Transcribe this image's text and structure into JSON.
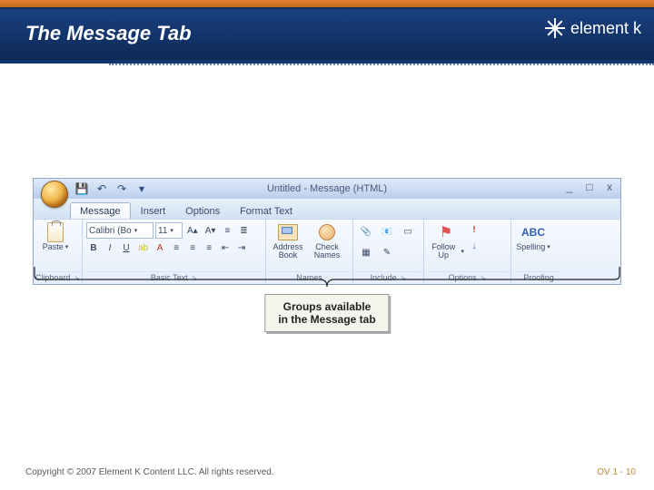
{
  "brand": "element k",
  "page_title": "The Message Tab",
  "window": {
    "title": "Untitled - Message (HTML)",
    "qat": [
      "save-icon",
      "undo-icon",
      "redo-icon"
    ],
    "controls": {
      "min": "_",
      "max": "□",
      "close": "x"
    }
  },
  "tabs": [
    {
      "label": "Message",
      "active": true
    },
    {
      "label": "Insert",
      "active": false
    },
    {
      "label": "Options",
      "active": false
    },
    {
      "label": "Format Text",
      "active": false
    }
  ],
  "groups": {
    "clipboard": {
      "label": "Clipboard",
      "paste": "Paste"
    },
    "basictext": {
      "label": "Basic Text",
      "font": "Calibri (Bo",
      "size": "11",
      "btns": {
        "bold": "B",
        "italic": "I",
        "underline": "U"
      }
    },
    "names": {
      "label": "Names",
      "address": "Address Book",
      "check": "Check Names"
    },
    "include": {
      "label": "Include"
    },
    "options": {
      "label": "Options",
      "followup": "Follow Up"
    },
    "proofing": {
      "label": "Proofing",
      "spelling": "Spelling",
      "abc": "ABC"
    }
  },
  "callout": {
    "line1": "Groups available",
    "line2": "in the Message tab"
  },
  "footer": {
    "copyright": "Copyright © 2007 Element K Content LLC. All rights reserved.",
    "pageno": "OV 1 - 10"
  }
}
